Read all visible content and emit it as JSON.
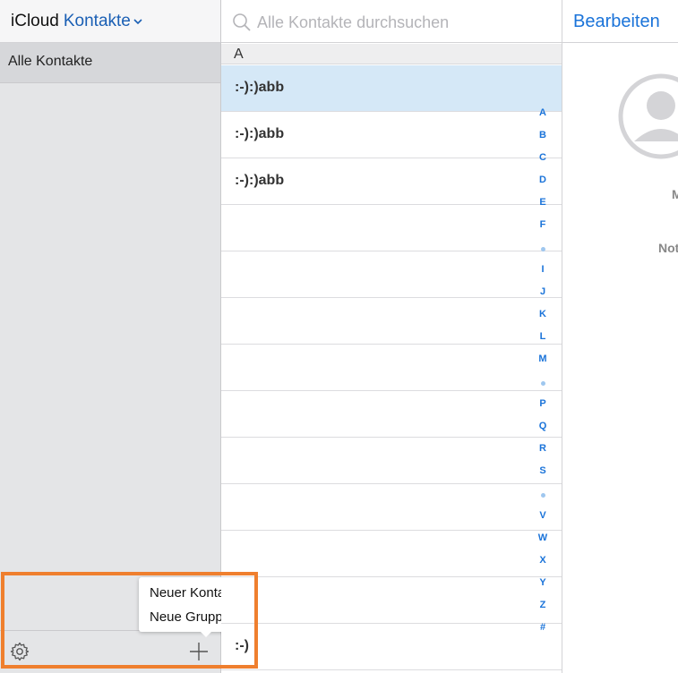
{
  "header": {
    "brand": "iCloud",
    "module": "Kontakte"
  },
  "sidebar": {
    "groups": [
      {
        "label": "Alle Kontakte"
      }
    ]
  },
  "popup_menu": {
    "items": [
      {
        "label": "Neuer Kontakt"
      },
      {
        "label": "Neue Gruppe"
      }
    ]
  },
  "search": {
    "placeholder": "Alle Kontakte durchsuchen"
  },
  "list": {
    "section": "A",
    "contacts": [
      {
        "name": ":-):)abb",
        "selected": true
      },
      {
        "name": ":-):)abb"
      },
      {
        "name": ":-):)abb"
      },
      {
        "name": ""
      },
      {
        "name": ""
      },
      {
        "name": ""
      },
      {
        "name": ""
      },
      {
        "name": ""
      },
      {
        "name": ""
      },
      {
        "name": ""
      },
      {
        "name": ""
      },
      {
        "name": ""
      },
      {
        "name": ":-)"
      }
    ],
    "index": [
      "A",
      "B",
      "C",
      "D",
      "E",
      "F",
      "•",
      "I",
      "J",
      "K",
      "L",
      "M",
      "•",
      "P",
      "Q",
      "R",
      "S",
      "•",
      "V",
      "W",
      "X",
      "Y",
      "Z",
      "#"
    ]
  },
  "detail": {
    "edit_label": "Bearbeiten",
    "field_1": "M",
    "field_2": "Not"
  },
  "colors": {
    "accent": "#1a73d9",
    "brand_blue": "#1a5fb4",
    "selected_row": "#d5e8f7",
    "highlight": "#ef7f2e",
    "sidebar_bg": "#e4e5e7"
  }
}
